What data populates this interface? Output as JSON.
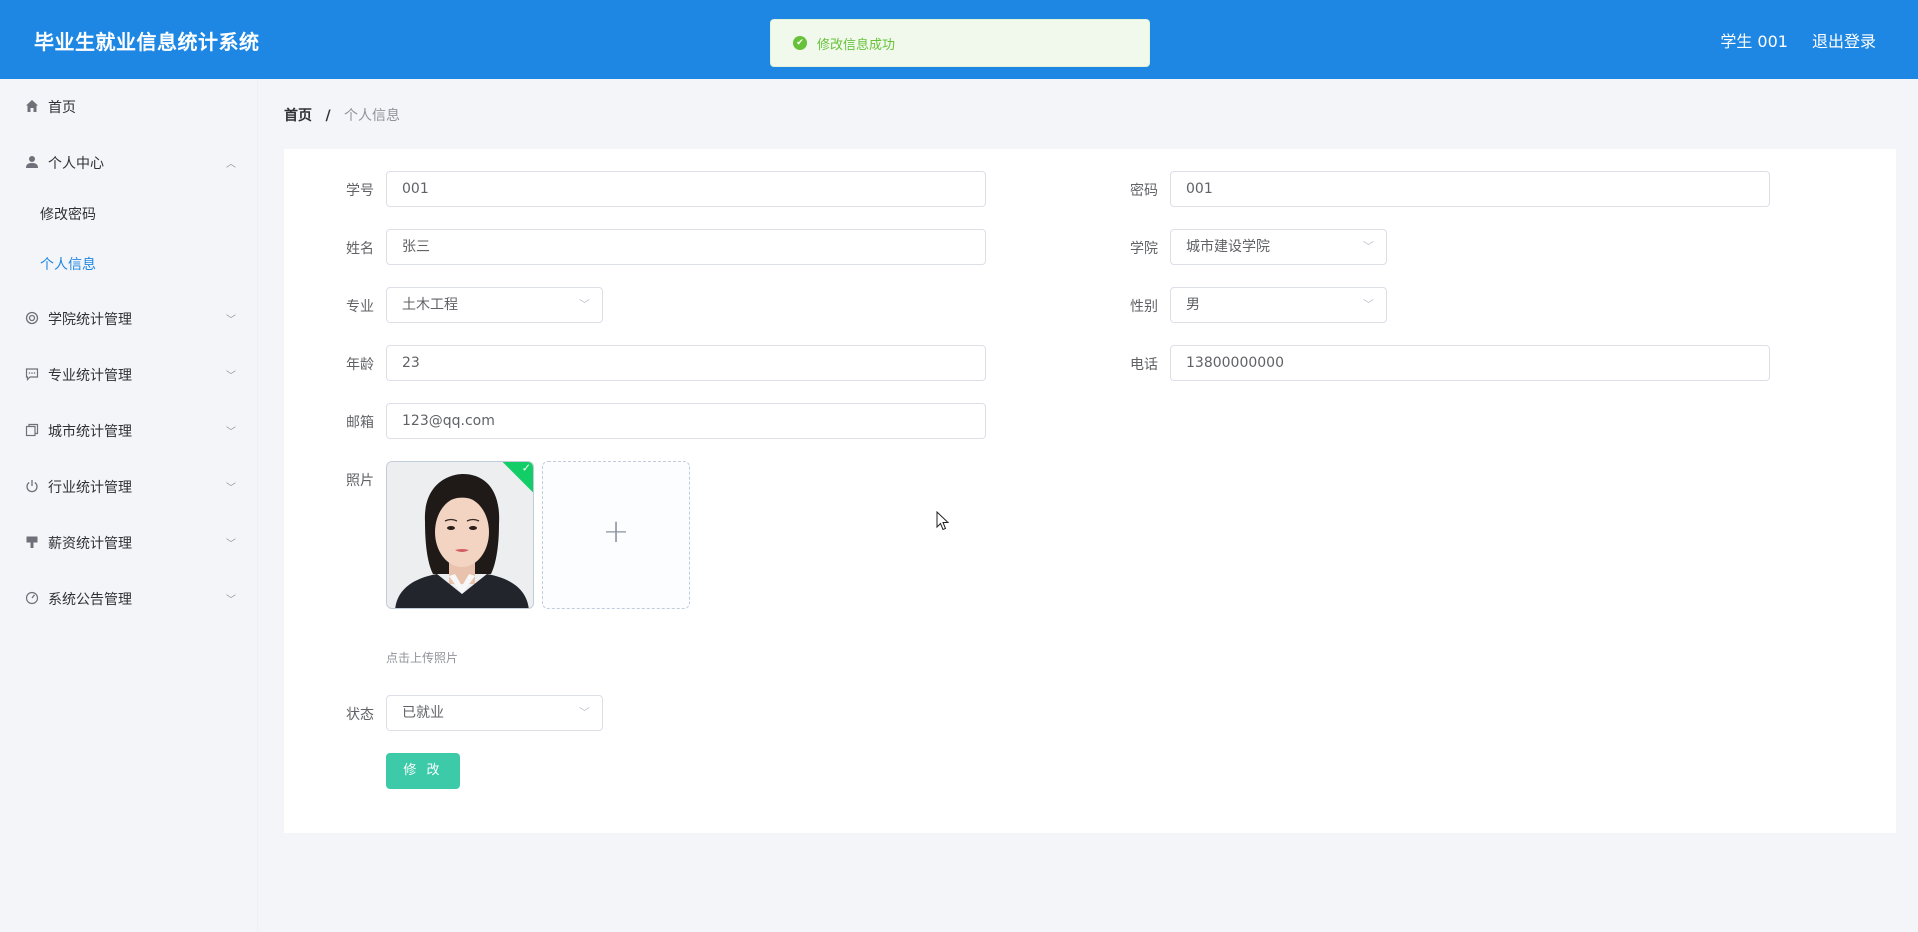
{
  "header": {
    "title": "毕业生就业信息统计系统",
    "user": "学生 001",
    "logout": "退出登录"
  },
  "toast": {
    "message": "修改信息成功"
  },
  "sidebar": {
    "home": "首页",
    "personal_center": "个人中心",
    "change_password": "修改密码",
    "personal_info": "个人信息",
    "college_stats": "学院统计管理",
    "major_stats": "专业统计管理",
    "city_stats": "城市统计管理",
    "industry_stats": "行业统计管理",
    "salary_stats": "薪资统计管理",
    "notice_mgmt": "系统公告管理"
  },
  "breadcrumb": {
    "home": "首页",
    "separator": "/",
    "current": "个人信息"
  },
  "form": {
    "student_id": {
      "label": "学号",
      "value": "001"
    },
    "password": {
      "label": "密码",
      "value": "001"
    },
    "name": {
      "label": "姓名",
      "value": "张三"
    },
    "college": {
      "label": "学院",
      "value": "城市建设学院"
    },
    "major": {
      "label": "专业",
      "value": "土木工程"
    },
    "gender": {
      "label": "性别",
      "value": "男"
    },
    "age": {
      "label": "年龄",
      "value": "23"
    },
    "phone": {
      "label": "电话",
      "value": "13800000000"
    },
    "email": {
      "label": "邮箱",
      "value": "123@qq.com"
    },
    "photo": {
      "label": "照片",
      "tip": "点击上传照片"
    },
    "status": {
      "label": "状态",
      "value": "已就业"
    },
    "submit": "修 改"
  },
  "colors": {
    "header": "#1e87e3",
    "button": "#3ccaa8",
    "active": "#1e87e3",
    "success": "#67c23a"
  }
}
